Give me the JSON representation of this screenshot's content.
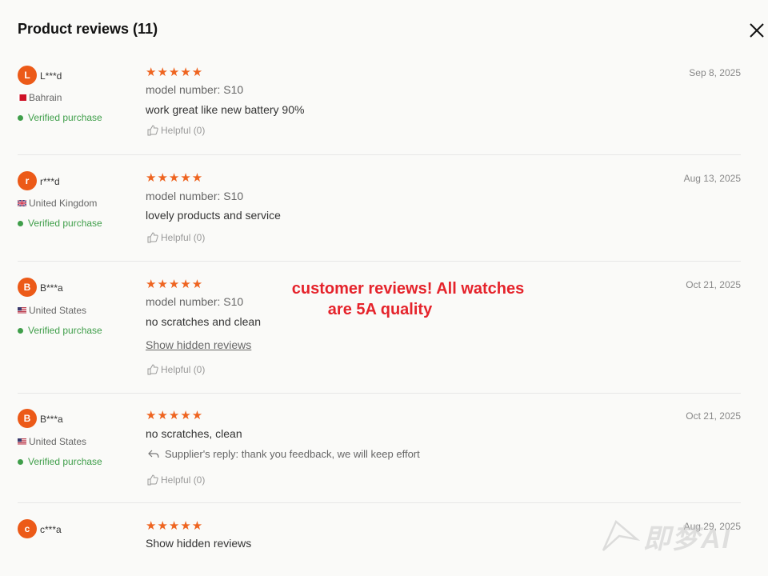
{
  "header": {
    "title": "Product reviews (11)"
  },
  "reviews": [
    {
      "initial": "L",
      "user": "L***d",
      "country": "Bahrain",
      "verified": "Verified purchase",
      "stars": "★★★★★",
      "rating": 5,
      "model": "model number:  S10",
      "text": "work great like new battery 90%",
      "helpful": "Helpful (0)",
      "date": "Sep 8, 2025"
    },
    {
      "initial": "r",
      "user": "r***d",
      "country": "United Kingdom",
      "verified": "Verified purchase",
      "stars": "★★★★★",
      "rating": 5,
      "model": "model number:  S10",
      "text": "lovely products and service",
      "helpful": "Helpful (0)",
      "date": "Aug 13, 2025"
    },
    {
      "initial": "B",
      "user": "B***a",
      "country": "United States",
      "verified": "Verified purchase",
      "stars": "★★★★★",
      "rating": 5,
      "model": "model number:  S10",
      "text": "no scratches and clean",
      "link": "Show hidden reviews",
      "helpful": "Helpful (0)",
      "date": "Oct 21, 2025"
    },
    {
      "initial": "B",
      "user": "B***a",
      "country": "United States",
      "verified": "Verified purchase",
      "stars": "★★★★★",
      "rating": 5,
      "text": "no scratches, clean",
      "reply": "Supplier's reply: thank you feedback, we will keep effort",
      "helpful": "Helpful (0)",
      "date": "Oct 21, 2025"
    },
    {
      "initial": "c",
      "user": "c***a",
      "stars": "★★★★★",
      "rating": 5,
      "text": "Show hidden reviews",
      "date": "Aug 29, 2025"
    }
  ],
  "overlay": {
    "line1": "customer reviews! All watches",
    "line2": "are 5A quality"
  },
  "watermark": "即梦AI",
  "colors": {
    "accent": "#ec5a18",
    "star": "#ee6420",
    "verified": "#3f9e4a",
    "promo": "#e5232b"
  }
}
